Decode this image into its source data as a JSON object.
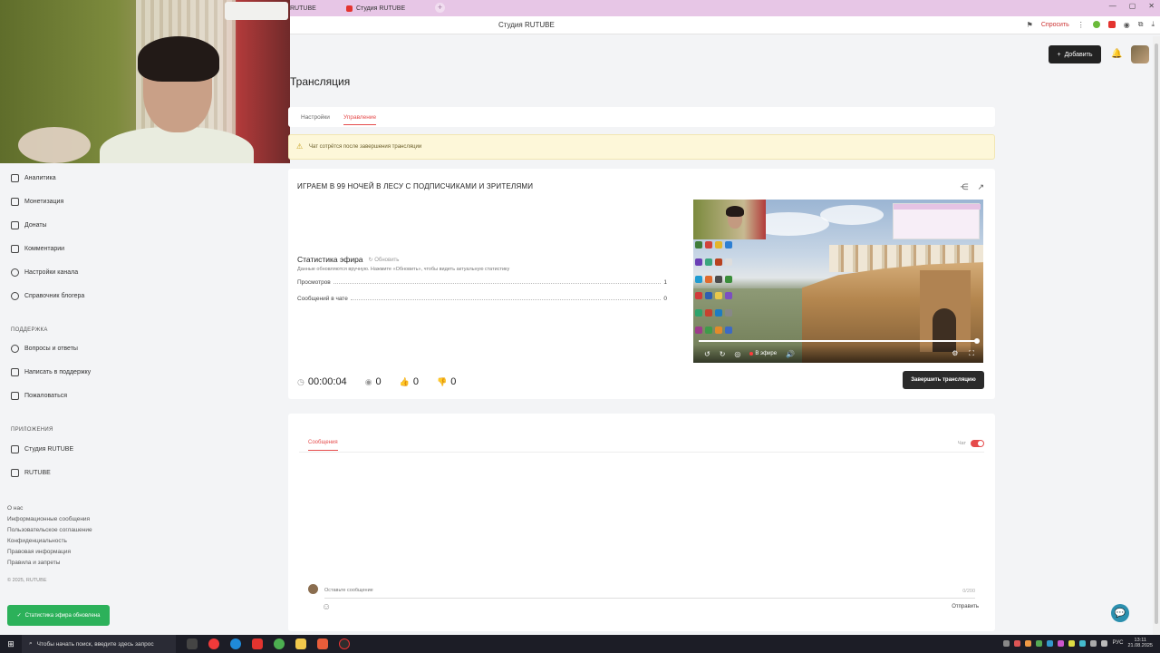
{
  "browser": {
    "tabs": [
      {
        "label": "RUTUBE"
      },
      {
        "label": "Студия RUTUBE"
      }
    ],
    "new_tab": "+",
    "page_title": "Студия RUTUBE",
    "ask_label": "Спросить",
    "window_controls": [
      "—",
      "▢",
      "✕"
    ]
  },
  "header": {
    "add_label": "Добавить"
  },
  "sidebar": {
    "items": [
      {
        "label": "Аналитика",
        "icon": "chart-icon"
      },
      {
        "label": "Монетизация",
        "icon": "coin-icon"
      },
      {
        "label": "Донаты",
        "icon": "gift-icon"
      },
      {
        "label": "Комментарии",
        "icon": "comment-icon"
      },
      {
        "label": "Настройки канала",
        "icon": "gear-icon"
      },
      {
        "label": "Справочник блогера",
        "icon": "info-icon"
      }
    ],
    "support_title": "ПОДДЕРЖКА",
    "support_items": [
      {
        "label": "Вопросы и ответы"
      },
      {
        "label": "Написать в поддержку"
      },
      {
        "label": "Пожаловаться"
      }
    ],
    "apps_title": "ПРИЛОЖЕНИЯ",
    "apps_items": [
      {
        "label": "Студия RUTUBE"
      },
      {
        "label": "RUTUBE"
      }
    ],
    "footer_links": [
      "О нас",
      "Информационные сообщения",
      "Пользовательское соглашение",
      "Конфиденциальность",
      "Правовая информация",
      "Правила и запреты"
    ],
    "copyright": "© 2025, RUTUBE",
    "toast": "Статистика эфира обновлена"
  },
  "main": {
    "title": "Трансляция",
    "tabs": [
      {
        "label": "Настройки",
        "active": false
      },
      {
        "label": "Управление",
        "active": true
      }
    ],
    "warning": "Чат сотрётся после завершения трансляции",
    "stream": {
      "title": "ИГРАЕМ В 99 НОЧЕЙ В ЛЕСУ С ПОДПИСЧИКАМИ И ЗРИТЕЛЯМИ",
      "stats_title": "Статистика эфира",
      "refresh_label": "Обновить",
      "stats_hint": "Данные обновляются вручную. Нажмите «Обновить», чтобы видеть актуальную статистику",
      "stats": [
        {
          "label": "Просмотров",
          "value": "1"
        },
        {
          "label": "Сообщений в чате",
          "value": "0"
        }
      ],
      "timer": "00:00:04",
      "viewers": "0",
      "likes": "0",
      "dislikes": "0",
      "end_button": "Завершить трансляцию",
      "player": {
        "live_label": "В эфире",
        "progress": 1.0
      }
    },
    "chat": {
      "tab_label": "Сообщения",
      "toggle_label": "Чат",
      "toggle_on": true,
      "input_placeholder": "Оставьте сообщение",
      "char_count": "0/200",
      "send_label": "Отправить"
    }
  },
  "taskbar": {
    "search_placeholder": "Чтобы начать поиск, введите здесь запрос",
    "lang": "РУС",
    "time": "13:11",
    "date": "21.08.2025"
  },
  "colors": {
    "accent": "#e54b4b",
    "tab_bar": "#e7c6e6",
    "success": "#2cb15a",
    "warning_bg": "#fdf7d9"
  }
}
